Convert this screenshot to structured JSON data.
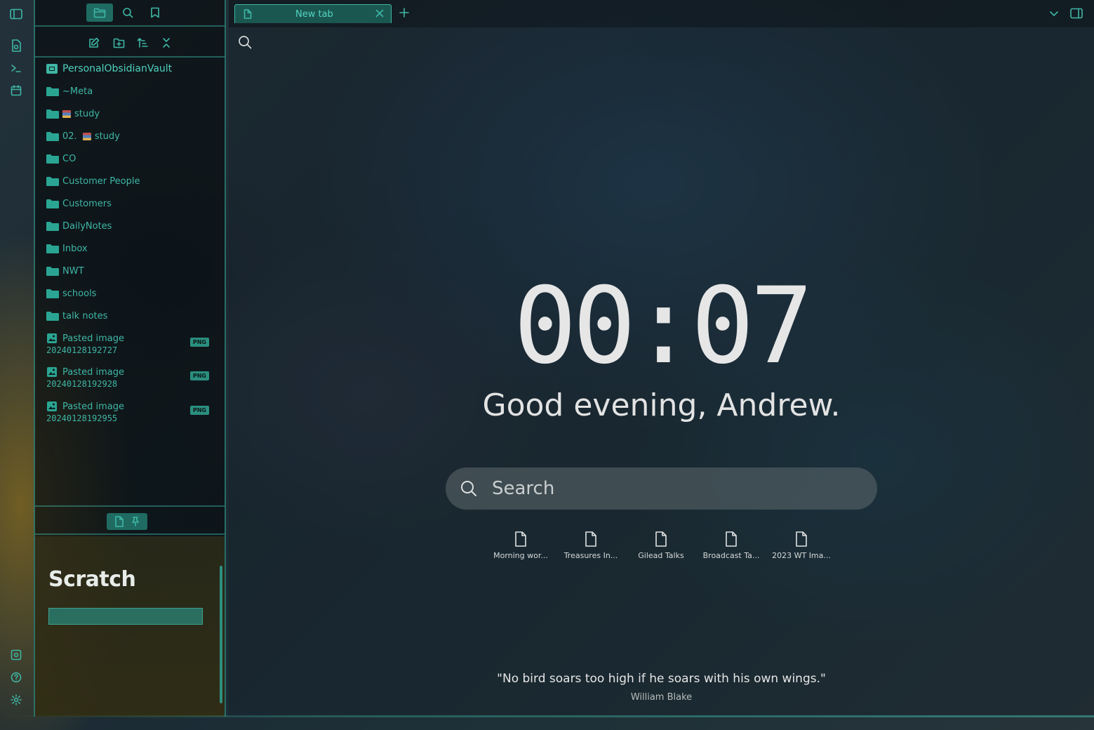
{
  "ribbon": {
    "icons": [
      "sidebar-toggle-icon",
      "open-quick-switcher-icon",
      "terminal-icon",
      "calendar-icon",
      "vault-switch-icon",
      "help-icon",
      "settings-icon"
    ]
  },
  "sidebar": {
    "tabs": [
      "files-icon",
      "search-icon",
      "bookmark-icon"
    ],
    "actions": [
      "new-note-icon",
      "new-folder-icon",
      "sort-icon",
      "collapse-all-icon"
    ],
    "vault_name": "PersonalObsidianVault",
    "folders": [
      {
        "label": "~Meta"
      },
      {
        "label": "study",
        "emoji": "books"
      },
      {
        "label": "02. ",
        "suffix": "study",
        "emoji": "books"
      },
      {
        "label": "CO"
      },
      {
        "label": "Customer People"
      },
      {
        "label": "Customers"
      },
      {
        "label": "DailyNotes"
      },
      {
        "label": "Inbox"
      },
      {
        "label": "NWT"
      },
      {
        "label": "schools"
      },
      {
        "label": "talk notes"
      }
    ],
    "files": [
      {
        "line1": "Pasted image",
        "line2": "20240128192727",
        "badge": "PNG"
      },
      {
        "line1": "Pasted image",
        "line2": "20240128192928",
        "badge": "PNG"
      },
      {
        "line1": "Pasted image",
        "line2": "20240128192955",
        "badge": "PNG"
      }
    ],
    "scratch_title": "Scratch"
  },
  "tabs": [
    {
      "label": "New tab",
      "active": true
    }
  ],
  "home": {
    "clock": "00:07",
    "greeting": "Good evening, Andrew.",
    "search_placeholder": "Search",
    "recent_files": [
      "Morning wor...",
      "Treasures In...",
      "Gilead Talks",
      "Broadcast Ta...",
      "2023 WT Ima..."
    ],
    "quote": "\"No bird soars too high if he soars with his own wings.\"",
    "quote_author": "William Blake"
  },
  "colors": {
    "accent": "#3fb6a5",
    "accent_dark": "#1f6b62",
    "text": "#e6e6e6"
  }
}
